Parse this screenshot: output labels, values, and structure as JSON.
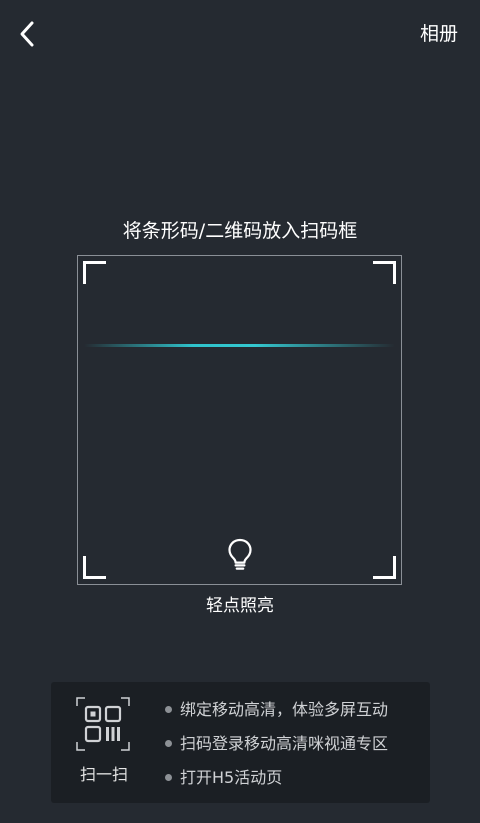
{
  "header": {
    "back_icon": "chevron-left-icon",
    "album_label": "相册"
  },
  "scanner": {
    "hint": "将条形码/二维码放入扫码框",
    "scan_line_color": "#2fc3cc",
    "light_icon": "lightbulb-icon",
    "torch_label": "轻点照亮"
  },
  "info": {
    "qr_icon": "qr-code-icon",
    "scan_label": "扫一扫",
    "features": [
      "绑定移动高清，体验多屏互动",
      "扫码登录移动高清咪视通专区",
      "打开H5活动页"
    ]
  },
  "colors": {
    "background": "#252a31",
    "panel": "#1b1f24",
    "accent": "#2fc3cc"
  }
}
